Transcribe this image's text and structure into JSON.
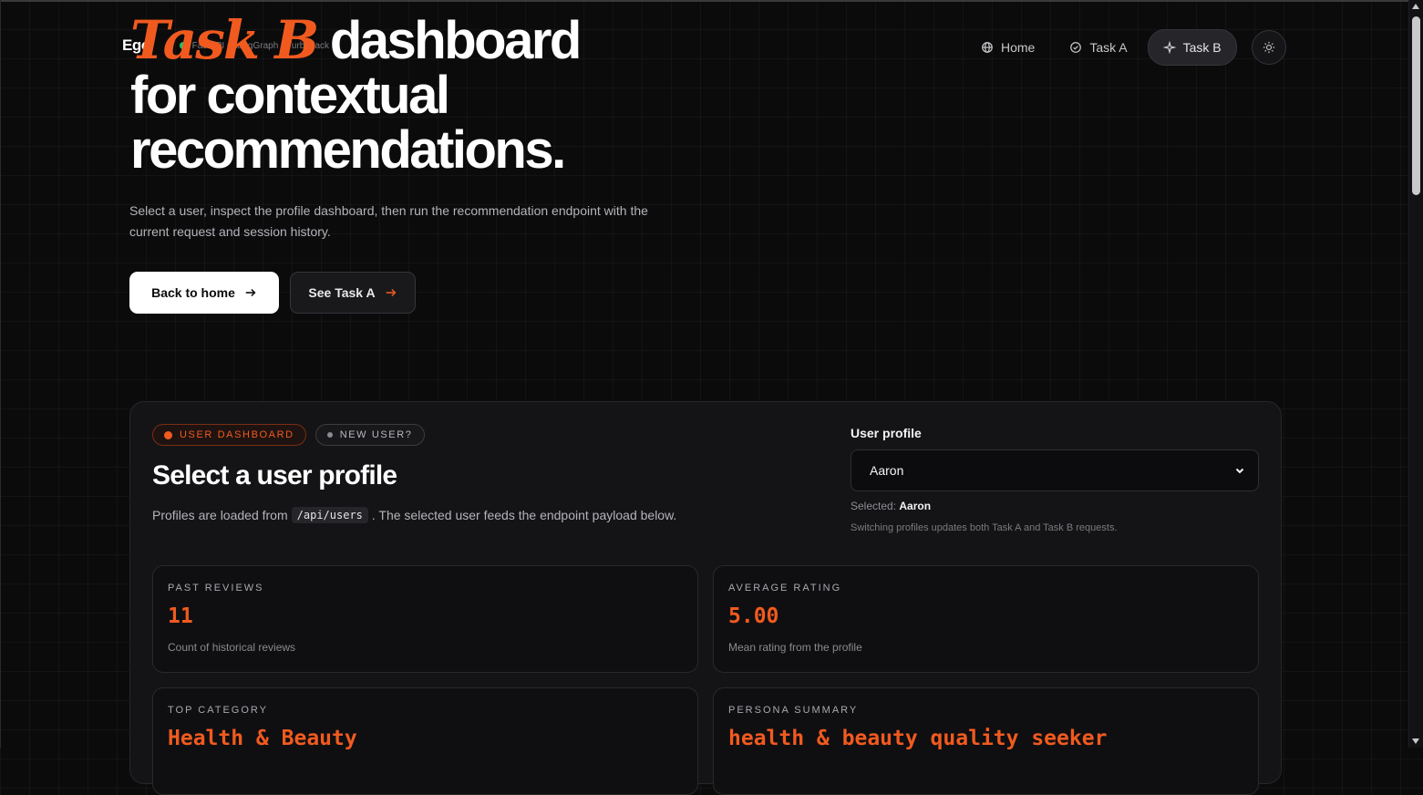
{
  "brand": {
    "name": "Ego",
    "tagline": "FastAPI • LangGraph • Turbopack"
  },
  "nav": {
    "items": [
      {
        "label": "Home",
        "icon": "globe-icon"
      },
      {
        "label": "Task A",
        "icon": "check-circle-icon"
      },
      {
        "label": "Task B",
        "icon": "sparkle-icon",
        "active": true
      }
    ],
    "theme_icon": "sun-icon"
  },
  "hero": {
    "title_accent": "Task B",
    "title_line1_rest": " dashboard",
    "title_line2": "for contextual",
    "title_line3": "recommendations.",
    "subtitle": "Select a user, inspect the profile dashboard, then run the recommendation endpoint with the current request and session history.",
    "primary_button": "Back to home",
    "secondary_button": "See Task A"
  },
  "dashboard": {
    "badge_primary": "USER DASHBOARD",
    "badge_secondary": "NEW USER?",
    "title": "Select a user profile",
    "desc_before": "Profiles are loaded from",
    "desc_code": "/api/users",
    "desc_after": ". The selected user feeds the endpoint payload below.",
    "profile": {
      "label": "User profile",
      "value": "Aaron",
      "selected_prefix": "Selected:",
      "selected_value": "Aaron",
      "note": "Switching profiles updates both Task A and Task B requests."
    },
    "stats": [
      {
        "label": "PAST REVIEWS",
        "value": "11",
        "desc": "Count of historical reviews"
      },
      {
        "label": "AVERAGE RATING",
        "value": "5.00",
        "desc": "Mean rating from the profile"
      },
      {
        "label": "TOP CATEGORY",
        "value": "Health & Beauty",
        "desc": ""
      },
      {
        "label": "PERSONA SUMMARY",
        "value": "health & beauty quality seeker",
        "desc": ""
      }
    ]
  },
  "colors": {
    "accent": "#f15a1f",
    "background": "#0b0b0c",
    "card": "#141416",
    "status_dot": "#22c55e"
  }
}
